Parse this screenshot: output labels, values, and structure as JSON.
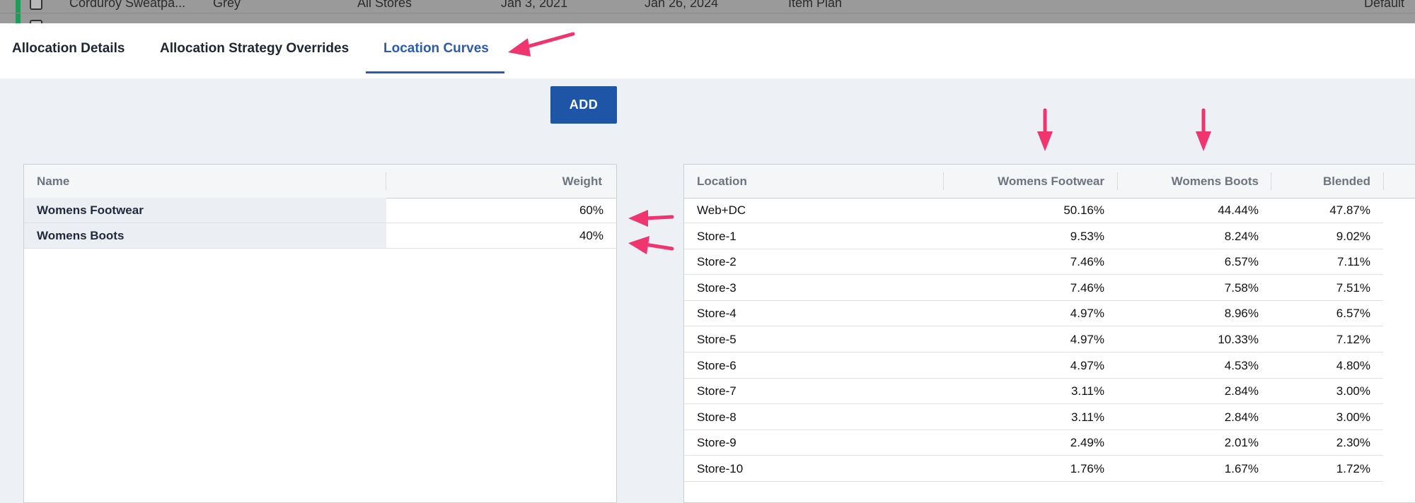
{
  "background_grid": {
    "rows": [
      {
        "name": "Corduroy Sweatpa...",
        "color": "Grey",
        "scope": "All Stores",
        "start": "Jan 3, 2021",
        "end": "Jan 26, 2024",
        "source": "Item Plan",
        "strategy": "Default"
      }
    ]
  },
  "tabs": [
    {
      "label": "Allocation Details"
    },
    {
      "label": "Allocation Strategy Overrides"
    },
    {
      "label": "Location Curves"
    }
  ],
  "active_tab": "Location Curves",
  "add_button": {
    "label": "ADD"
  },
  "weights_table": {
    "headers": {
      "name": "Name",
      "weight": "Weight"
    },
    "rows": [
      {
        "name": "Womens Footwear",
        "weight": "60%"
      },
      {
        "name": "Womens Boots",
        "weight": "40%"
      }
    ]
  },
  "curves_table": {
    "headers": {
      "location": "Location",
      "col1": "Womens Footwear",
      "col2": "Womens Boots",
      "blended": "Blended"
    },
    "rows": [
      {
        "location": "Web+DC",
        "footwear": "50.16%",
        "boots": "44.44%",
        "blended": "47.87%"
      },
      {
        "location": "Store-1",
        "footwear": "9.53%",
        "boots": "8.24%",
        "blended": "9.02%"
      },
      {
        "location": "Store-2",
        "footwear": "7.46%",
        "boots": "6.57%",
        "blended": "7.11%"
      },
      {
        "location": "Store-3",
        "footwear": "7.46%",
        "boots": "7.58%",
        "blended": "7.51%"
      },
      {
        "location": "Store-4",
        "footwear": "4.97%",
        "boots": "8.96%",
        "blended": "6.57%"
      },
      {
        "location": "Store-5",
        "footwear": "4.97%",
        "boots": "10.33%",
        "blended": "7.12%"
      },
      {
        "location": "Store-6",
        "footwear": "4.97%",
        "boots": "4.53%",
        "blended": "4.80%"
      },
      {
        "location": "Store-7",
        "footwear": "3.11%",
        "boots": "2.84%",
        "blended": "3.00%"
      },
      {
        "location": "Store-8",
        "footwear": "3.11%",
        "boots": "2.84%",
        "blended": "3.00%"
      },
      {
        "location": "Store-9",
        "footwear": "2.49%",
        "boots": "2.01%",
        "blended": "2.30%"
      },
      {
        "location": "Store-10",
        "footwear": "1.76%",
        "boots": "1.67%",
        "blended": "1.72%"
      }
    ]
  },
  "colors": {
    "accent": "#2b5bb0",
    "button": "#1f55a7",
    "annotation_arrow": "#f0346e"
  }
}
